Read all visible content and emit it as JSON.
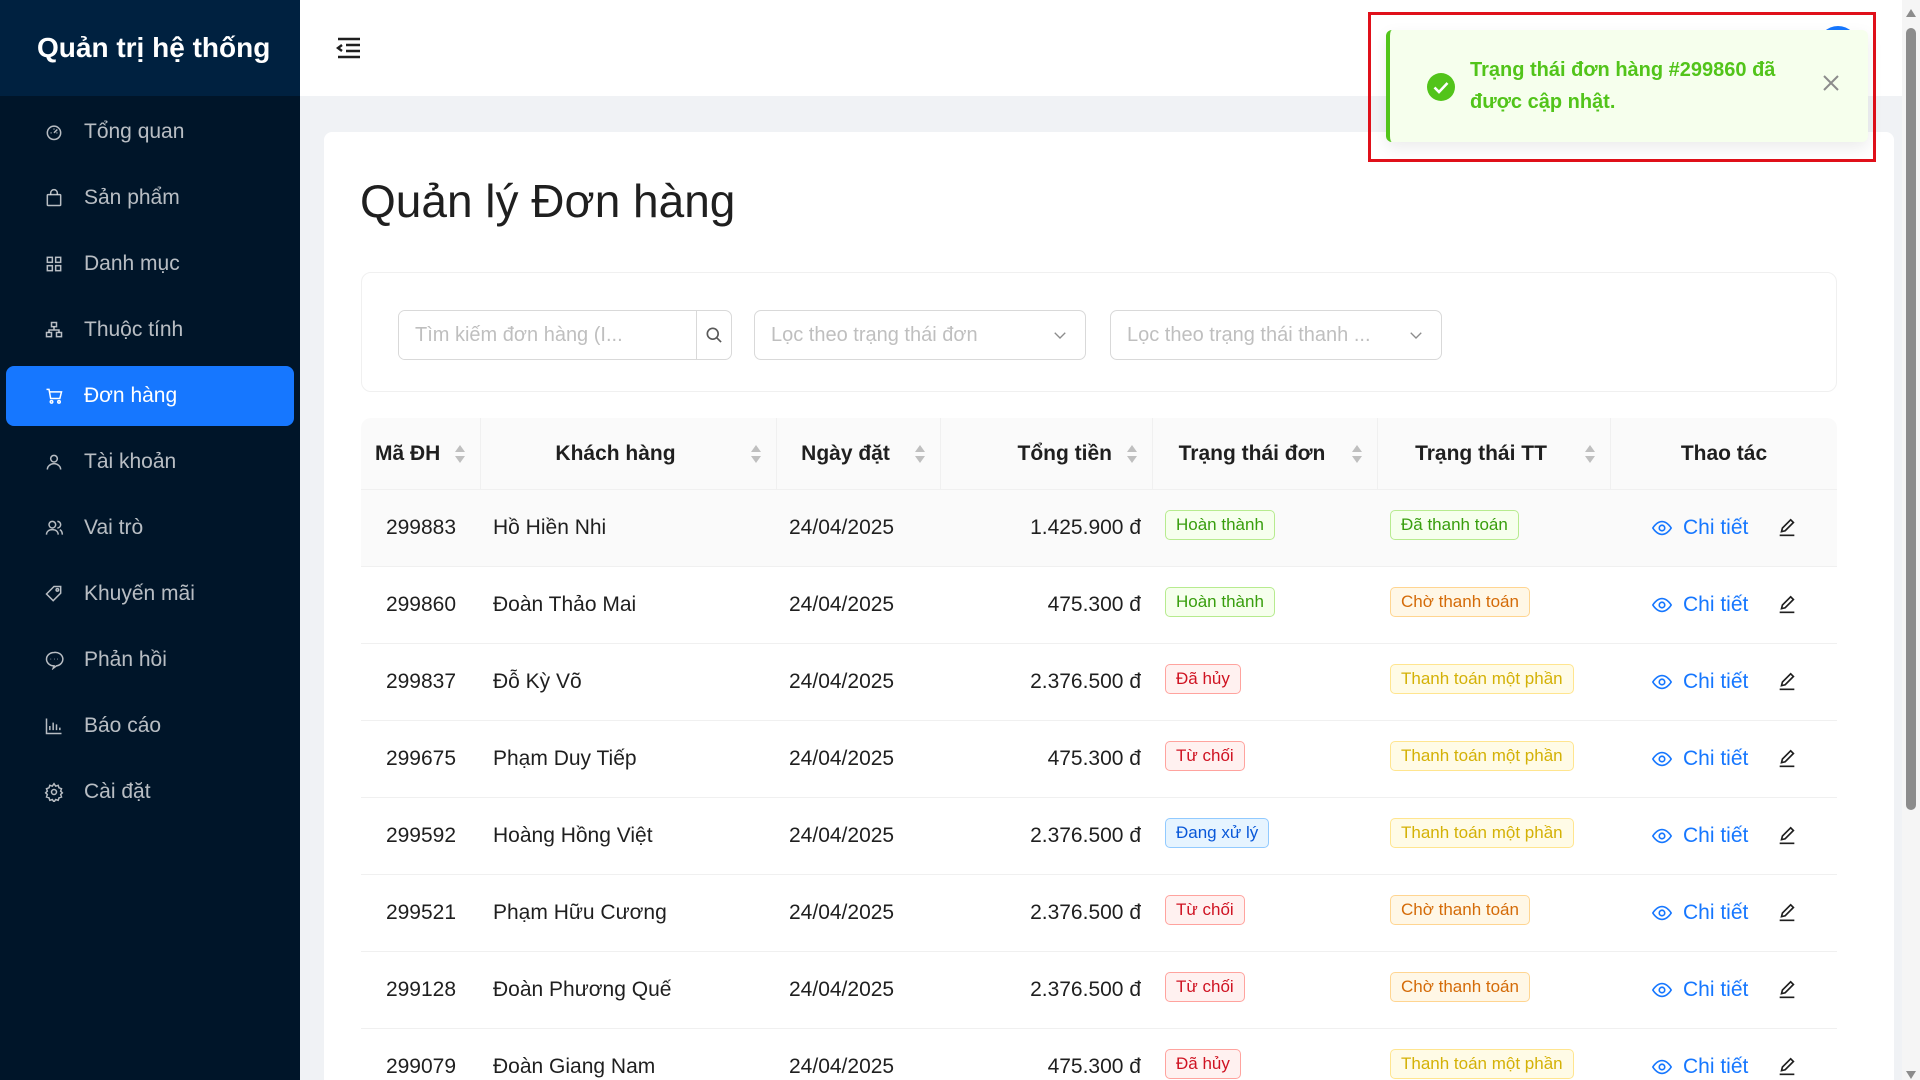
{
  "sidebar": {
    "brand": "Quản trị hệ thống",
    "items": [
      {
        "label": "Tổng quan",
        "icon": "dashboard-icon"
      },
      {
        "label": "Sản phẩm",
        "icon": "shopping-bag-icon"
      },
      {
        "label": "Danh mục",
        "icon": "grid-icon"
      },
      {
        "label": "Thuộc tính",
        "icon": "cluster-icon"
      },
      {
        "label": "Đơn hàng",
        "icon": "shopping-cart-icon",
        "active": true
      },
      {
        "label": "Tài khoản",
        "icon": "user-icon"
      },
      {
        "label": "Vai trò",
        "icon": "team-icon"
      },
      {
        "label": "Khuyến mãi",
        "icon": "tag-icon"
      },
      {
        "label": "Phản hồi",
        "icon": "message-icon"
      },
      {
        "label": "Báo cáo",
        "icon": "bar-chart-icon"
      },
      {
        "label": "Cài đặt",
        "icon": "gear-icon"
      }
    ]
  },
  "main": {
    "title": "Quản lý Đơn hàng",
    "filters": {
      "search_placeholder": "Tìm kiếm đơn hàng (I...",
      "order_status_placeholder": "Lọc theo trạng thái đơn",
      "payment_status_placeholder": "Lọc theo trạng thái thanh ..."
    },
    "table": {
      "columns": [
        "Mã ĐH",
        "Khách hàng",
        "Ngày đặt",
        "Tổng tiền",
        "Trạng thái đơn",
        "Trạng thái TT",
        "Thao tác"
      ],
      "detail_label": "Chi tiết",
      "rows": [
        {
          "id": "299883",
          "customer": "Hồ Hiền Nhi",
          "date": "24/04/2025",
          "total": "1.425.900 đ",
          "status": "Hoàn thành",
          "status_color": "green",
          "payment": "Đã thanh toán",
          "payment_color": "green"
        },
        {
          "id": "299860",
          "customer": "Đoàn Thảo Mai",
          "date": "24/04/2025",
          "total": "475.300 đ",
          "status": "Hoàn thành",
          "status_color": "green",
          "payment": "Chờ thanh toán",
          "payment_color": "orange"
        },
        {
          "id": "299837",
          "customer": "Đỗ Kỳ Võ",
          "date": "24/04/2025",
          "total": "2.376.500 đ",
          "status": "Đã hủy",
          "status_color": "red",
          "payment": "Thanh toán một phần",
          "payment_color": "gold"
        },
        {
          "id": "299675",
          "customer": "Phạm Duy Tiếp",
          "date": "24/04/2025",
          "total": "475.300 đ",
          "status": "Từ chối",
          "status_color": "red",
          "payment": "Thanh toán một phần",
          "payment_color": "gold"
        },
        {
          "id": "299592",
          "customer": "Hoàng Hồng Việt",
          "date": "24/04/2025",
          "total": "2.376.500 đ",
          "status": "Đang xử lý",
          "status_color": "blue",
          "payment": "Thanh toán một phần",
          "payment_color": "gold"
        },
        {
          "id": "299521",
          "customer": "Phạm Hữu Cương",
          "date": "24/04/2025",
          "total": "2.376.500 đ",
          "status": "Từ chối",
          "status_color": "red",
          "payment": "Chờ thanh toán",
          "payment_color": "orange"
        },
        {
          "id": "299128",
          "customer": "Đoàn Phương Quế",
          "date": "24/04/2025",
          "total": "2.376.500 đ",
          "status": "Từ chối",
          "status_color": "red",
          "payment": "Chờ thanh toán",
          "payment_color": "orange"
        },
        {
          "id": "299079",
          "customer": "Đoàn Giang Nam",
          "date": "24/04/2025",
          "total": "475.300 đ",
          "status": "Đã hủy",
          "status_color": "red",
          "payment": "Thanh toán một phần",
          "payment_color": "gold"
        }
      ]
    }
  },
  "toast": {
    "message": "Trạng thái đơn hàng #299860 đã được cập nhật.",
    "type": "success",
    "accent_color": "#52c41a",
    "highlight_color": "#e0101a"
  },
  "colors": {
    "sidebar_bg": "#001529",
    "primary": "#1677ff"
  }
}
